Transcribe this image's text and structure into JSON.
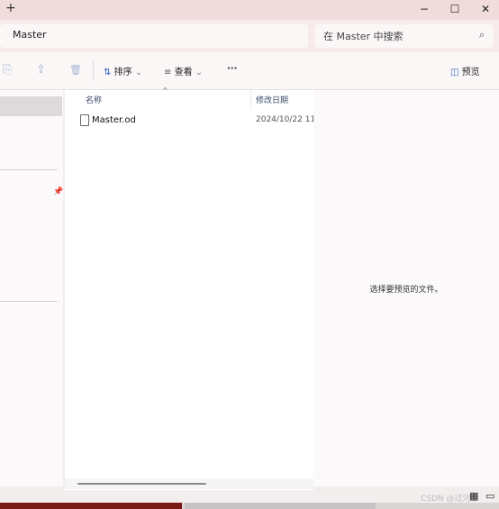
{
  "titlebar": {
    "new_tab": "+",
    "minimize": "−",
    "maximize": "☐",
    "close": "✕"
  },
  "address": {
    "path": "Master",
    "search_placeholder": "在 Master 中搜索",
    "search_icon": "⌕"
  },
  "toolbar": {
    "copy_icon": "⎘",
    "share_icon": "⇪",
    "delete_icon": "🗑",
    "sort_icon": "⇅",
    "sort_label": "排序",
    "sort_caret": "⌄",
    "view_icon": "≡",
    "view_label": "查看",
    "view_caret": "⌄",
    "more_label": "···",
    "preview_icon": "◫",
    "preview_label": "预览"
  },
  "nav": {
    "pin_icon": "📌"
  },
  "files": {
    "columns": {
      "name": "名称",
      "modified": "修改日期",
      "sort_caret": "^"
    },
    "rows": [
      {
        "name": "Master.od",
        "modified": "2024/10/22 11"
      }
    ]
  },
  "preview": {
    "message": "选择要预览的文件。"
  },
  "statusbar": {
    "details_icon": "▦",
    "preview_icon": "▭"
  },
  "watermark": "CSDN @过河卒"
}
